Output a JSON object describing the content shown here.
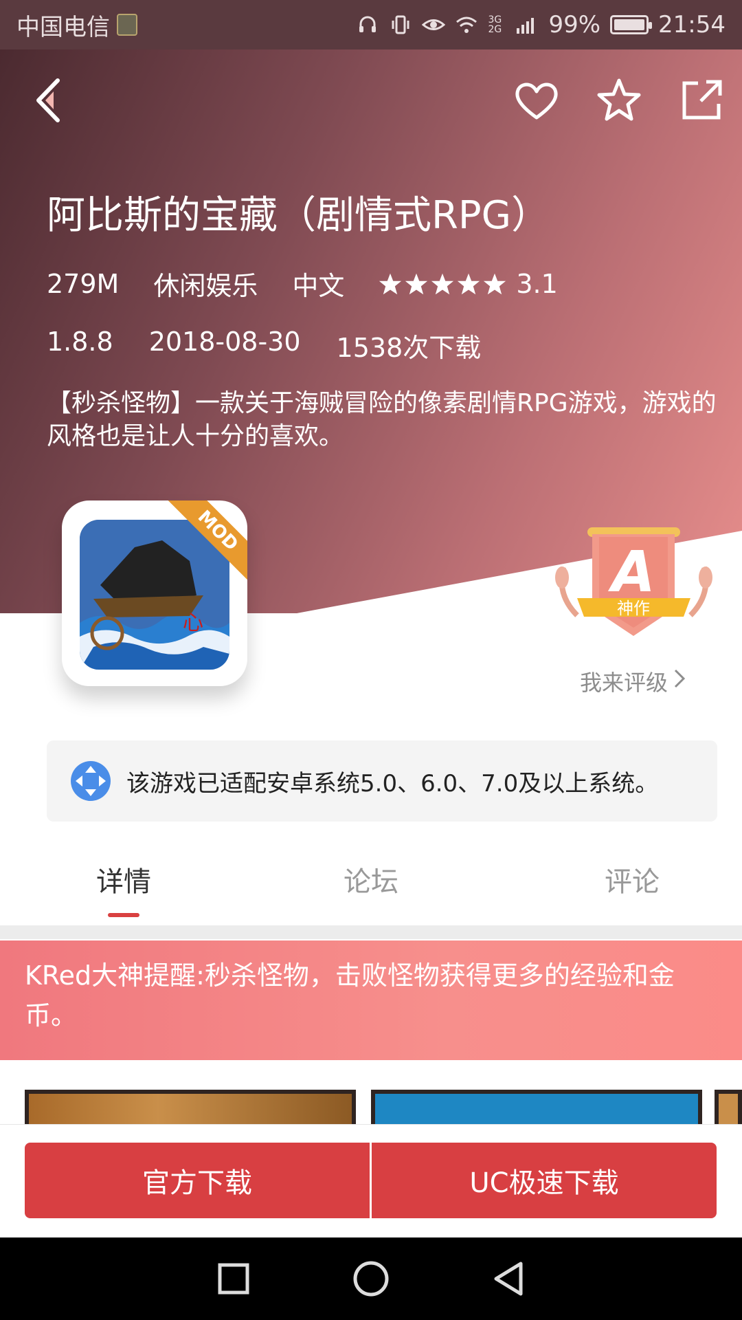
{
  "status_bar": {
    "carrier": "中国电信",
    "network": "3G 2G",
    "battery": "99%",
    "time": "21:54"
  },
  "app": {
    "title": "阿比斯的宝藏（剧情式RPG）",
    "size": "279M",
    "category": "休闲娱乐",
    "language": "中文",
    "rating": "3.1",
    "rating_stars": 5,
    "version": "1.8.8",
    "date": "2018-08-30",
    "downloads": "1538次下载",
    "description": "【秒杀怪物】一款关于海贼冒险的像素剧情RPG游戏，游戏的风格也是让人十分的喜欢。",
    "mod_label": "MOD"
  },
  "badge": {
    "grade": "A",
    "label": "神作",
    "rate_link": "我来评级"
  },
  "notice": {
    "text": "该游戏已适配安卓系统5.0、6.0、7.0及以上系统。"
  },
  "tabs": [
    {
      "label": "详情",
      "active": true
    },
    {
      "label": "论坛",
      "active": false
    },
    {
      "label": "评论",
      "active": false
    }
  ],
  "tip": {
    "text": "KRed大神提醒:秒杀怪物，击败怪物获得更多的经验和金币。"
  },
  "download": {
    "official": "官方下载",
    "uc": "UC极速下载"
  },
  "colors": {
    "accent": "#d83f42",
    "tip_bg": "#f7858a",
    "hero_start": "#4b2a30",
    "hero_end": "#e78e8c"
  }
}
